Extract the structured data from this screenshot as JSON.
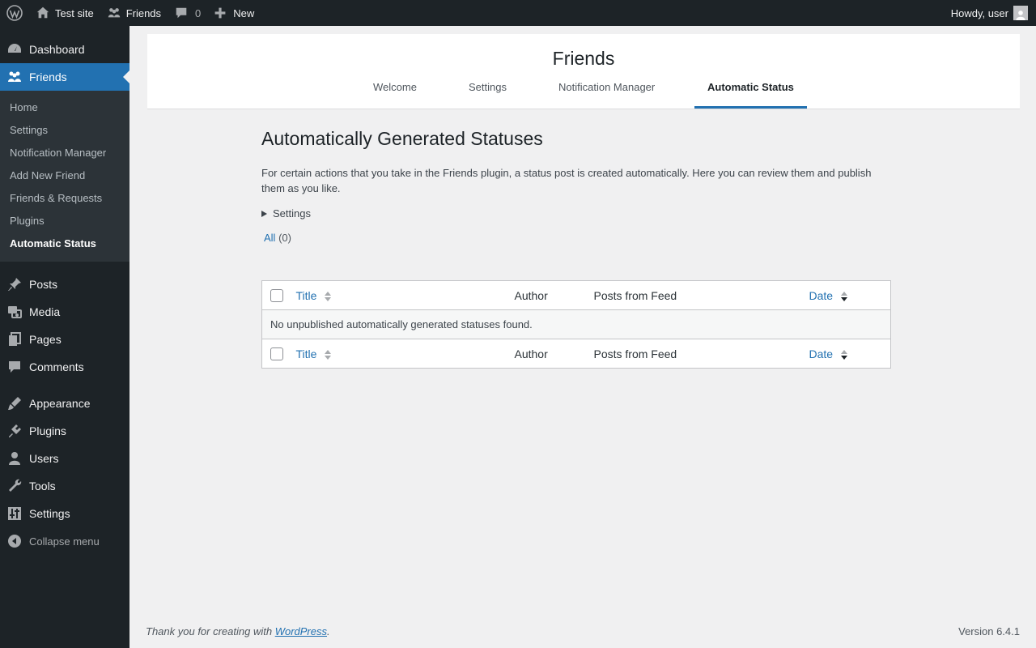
{
  "adminbar": {
    "site_name": "Test site",
    "friends_label": "Friends",
    "comments_count": "0",
    "new_label": "New",
    "howdy": "Howdy, user"
  },
  "sidebar": {
    "dashboard": "Dashboard",
    "friends": "Friends",
    "friends_sub": [
      "Home",
      "Settings",
      "Notification Manager",
      "Add New Friend",
      "Friends & Requests",
      "Plugins",
      "Automatic Status"
    ],
    "posts": "Posts",
    "media": "Media",
    "pages": "Pages",
    "comments": "Comments",
    "appearance": "Appearance",
    "plugins": "Plugins",
    "users": "Users",
    "tools": "Tools",
    "settings": "Settings",
    "collapse": "Collapse menu"
  },
  "header": {
    "title": "Friends",
    "tabs": [
      "Welcome",
      "Settings",
      "Notification Manager",
      "Automatic Status"
    ]
  },
  "main": {
    "heading": "Automatically Generated Statuses",
    "description": "For certain actions that you take in the Friends plugin, a status post is created automatically. Here you can review them and publish them as you like.",
    "settings_toggle": "Settings",
    "view_all": "All",
    "view_all_count": "(0)"
  },
  "table": {
    "columns": [
      "Title",
      "Author",
      "Posts from Feed",
      "Date"
    ],
    "empty_message": "No unpublished automatically generated statuses found."
  },
  "footer": {
    "thanks_prefix": "Thank you for creating with ",
    "wordpress_link": "WordPress",
    "thanks_suffix": ".",
    "version": "Version 6.4.1"
  },
  "colors": {
    "admin_bar_bg": "#1d2327",
    "accent": "#2271b1",
    "page_bg": "#f0f0f1"
  }
}
